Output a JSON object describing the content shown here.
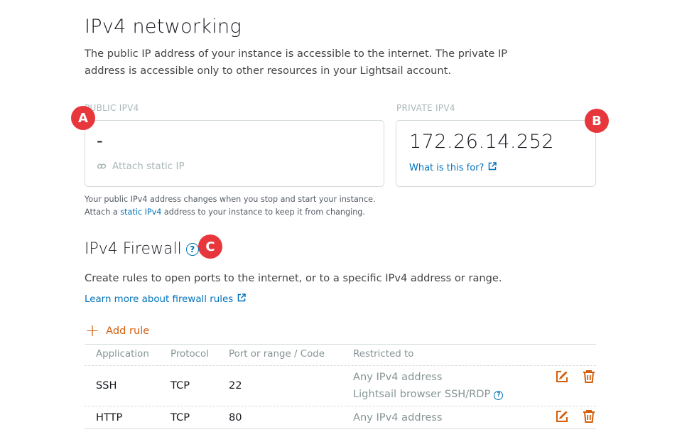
{
  "section": {
    "title": "IPv4 networking",
    "intro": "The public IP address of your instance is accessible to the internet. The private IP address is accessible only to other resources in your Lightsail account."
  },
  "public_ip": {
    "label": "PUBLIC IPV4",
    "value": "-",
    "attach_label": "Attach static IP",
    "note_line1": "Your public IPv4 address changes when you stop and start your instance.",
    "note_line2_pre": "Attach a ",
    "note_link": "static IPv4",
    "note_line2_post": " address to your instance to keep it from changing."
  },
  "private_ip": {
    "label": "PRIVATE IPV4",
    "value": "172.26.14.252",
    "what_link": "What is this for?"
  },
  "badges": {
    "a": "A",
    "b": "B",
    "c": "C"
  },
  "firewall": {
    "title": "IPv4 Firewall",
    "help": "?",
    "description": "Create rules to open ports to the internet, or to a specific IPv4 address or range.",
    "learn_more": "Learn more about firewall rules",
    "add_rule": "Add rule",
    "add_symbol": "+",
    "columns": [
      "Application",
      "Protocol",
      "Port or range / Code",
      "Restricted to"
    ],
    "rows": [
      {
        "application": "SSH",
        "protocol": "TCP",
        "port": "22",
        "restricted": "Any IPv4 address",
        "restricted2": "Lightsail browser SSH/RDP"
      },
      {
        "application": "HTTP",
        "protocol": "TCP",
        "port": "80",
        "restricted": "Any IPv4 address"
      }
    ]
  },
  "colors": {
    "accent": "#0073bb",
    "action_orange": "#d15f0f",
    "badge_red": "#e8373c"
  },
  "icons": {
    "attach": "link-icon",
    "external": "external-link-icon",
    "edit": "edit-icon",
    "delete": "trash-icon",
    "help": "help-circle-icon"
  }
}
